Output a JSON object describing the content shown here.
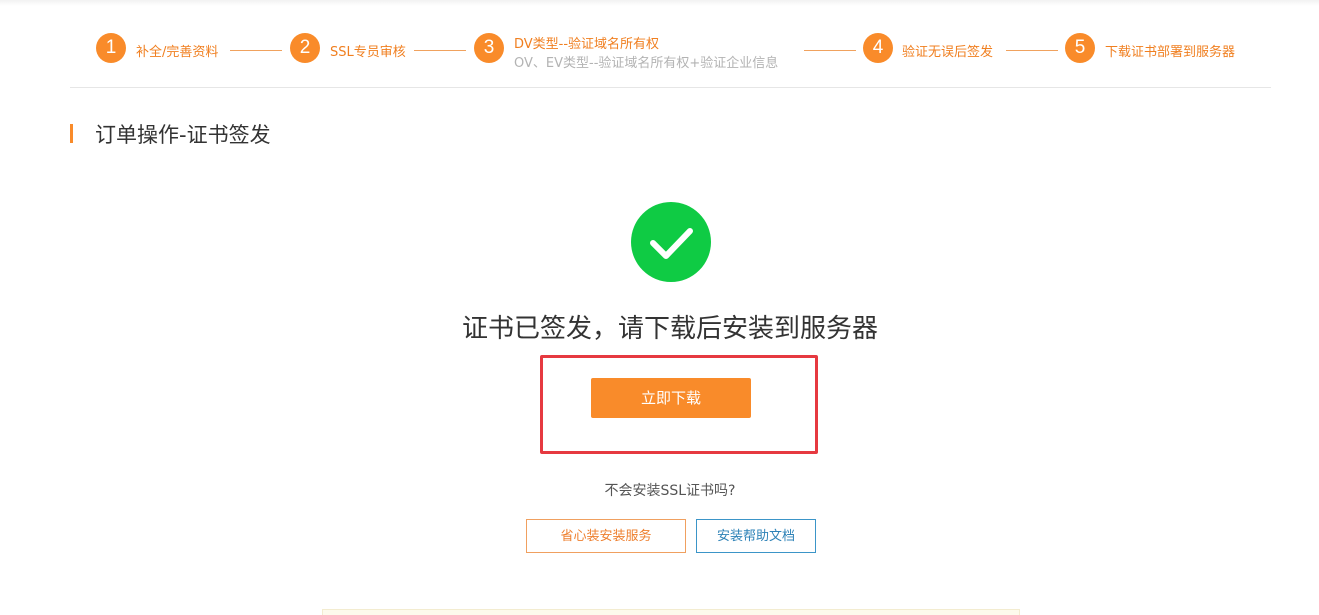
{
  "steps": [
    {
      "number": "1",
      "label": "补全/完善资料"
    },
    {
      "number": "2",
      "label": "SSL专员审核"
    },
    {
      "number": "3",
      "label": "DV类型--验证域名所有权",
      "sublabel": "OV、EV类型--验证域名所有权+验证企业信息"
    },
    {
      "number": "4",
      "label": "验证无误后签发"
    },
    {
      "number": "5",
      "label": "下载证书部署到服务器"
    }
  ],
  "section": {
    "title": "订单操作-证书签发"
  },
  "status": {
    "message": "证书已签发，请下载后安装到服务器"
  },
  "actions": {
    "download_label": "立即下载",
    "question": "不会安装SSL证书吗?",
    "install_service_label": "省心装安装服务",
    "help_docs_label": "安装帮助文档"
  },
  "colors": {
    "accent": "#f98b2a",
    "success": "#0fcb44",
    "highlight": "#e63940",
    "link_blue": "#2d82b7"
  },
  "icons": {
    "success": "check-icon"
  }
}
